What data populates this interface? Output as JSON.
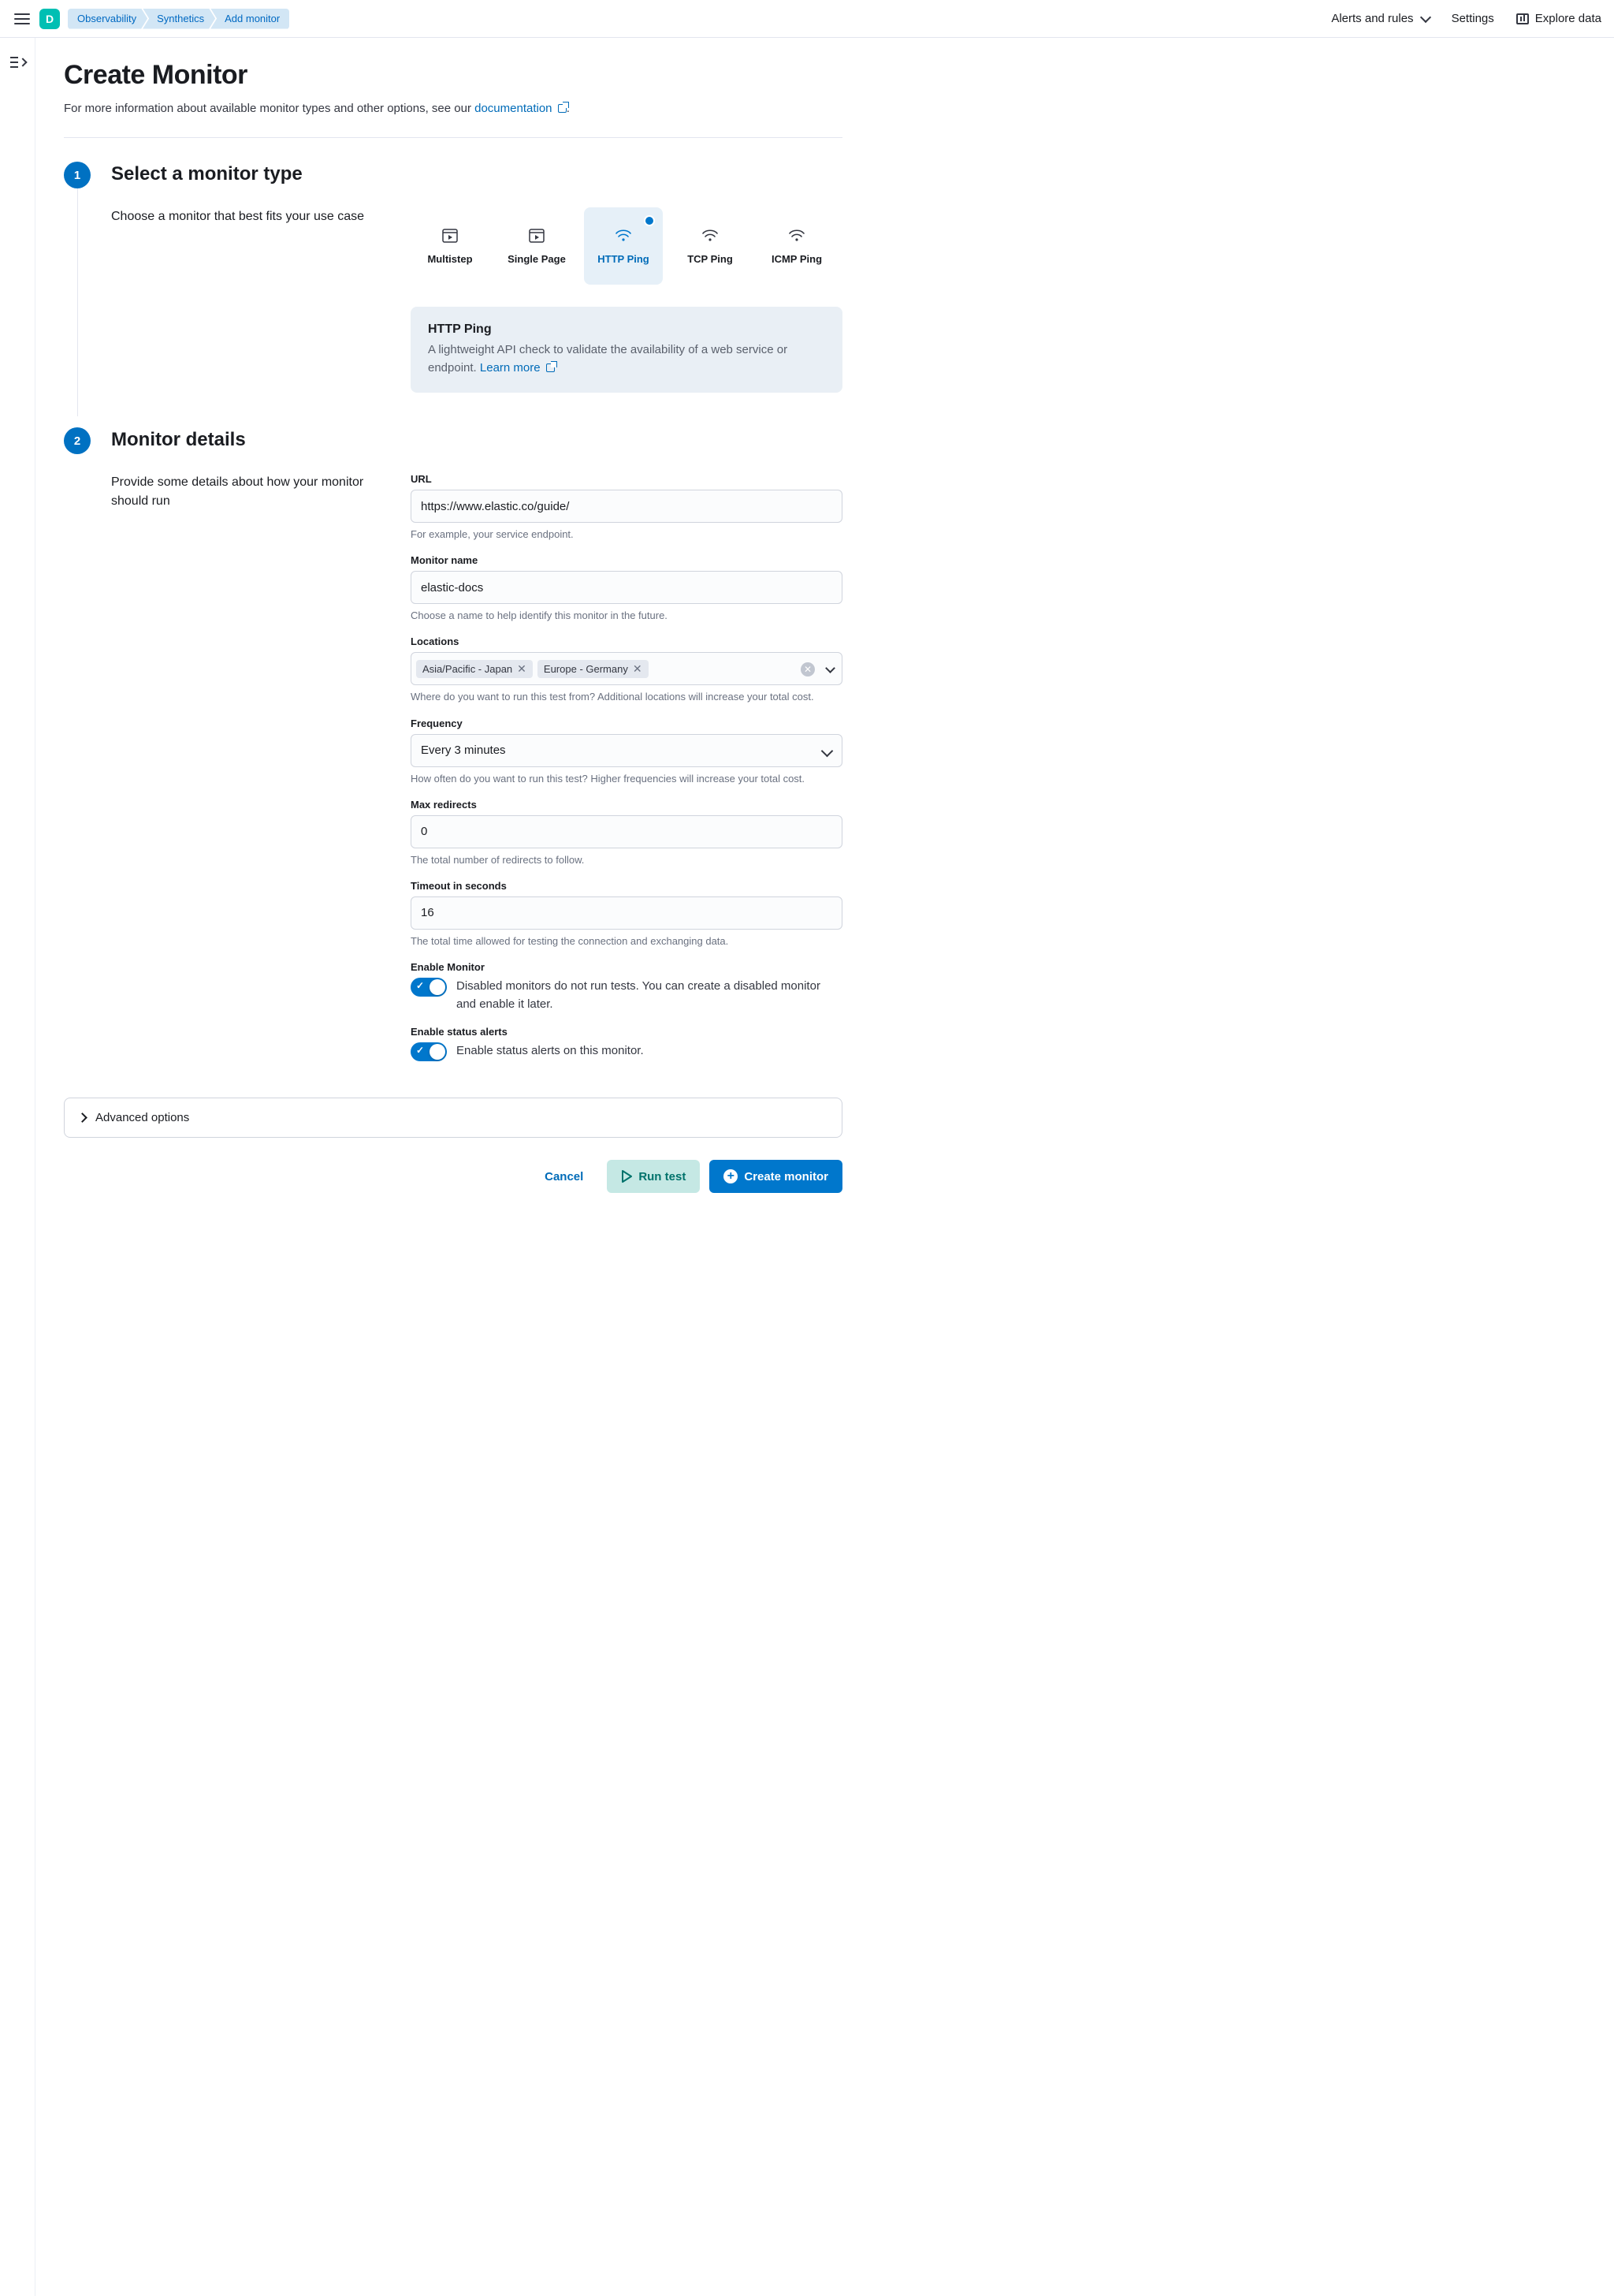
{
  "header": {
    "logo_letter": "D",
    "breadcrumbs": [
      "Observability",
      "Synthetics",
      "Add monitor"
    ],
    "alerts_label": "Alerts and rules",
    "settings_label": "Settings",
    "explore_label": "Explore data"
  },
  "page": {
    "title": "Create Monitor",
    "subtitle_prefix": "For more information about available monitor types and other options, see our ",
    "subtitle_link": "documentation",
    "subtitle_suffix": "."
  },
  "step1": {
    "number": "1",
    "title": "Select a monitor type",
    "desc": "Choose a monitor that best fits your use case",
    "types": [
      {
        "label": "Multistep"
      },
      {
        "label": "Single Page"
      },
      {
        "label": "HTTP Ping"
      },
      {
        "label": "TCP Ping"
      },
      {
        "label": "ICMP Ping"
      }
    ],
    "info_title": "HTTP Ping",
    "info_body": "A lightweight API check to validate the availability of a web service or endpoint. ",
    "info_link": "Learn more"
  },
  "step2": {
    "number": "2",
    "title": "Monitor details",
    "desc": "Provide some details about how your monitor should run",
    "url_label": "URL",
    "url_value": "https://www.elastic.co/guide/",
    "url_help": "For example, your service endpoint.",
    "name_label": "Monitor name",
    "name_value": "elastic-docs",
    "name_help": "Choose a name to help identify this monitor in the future.",
    "locations_label": "Locations",
    "locations": [
      "Asia/Pacific - Japan",
      "Europe - Germany"
    ],
    "locations_help": "Where do you want to run this test from? Additional locations will increase your total cost.",
    "freq_label": "Frequency",
    "freq_value": "Every 3 minutes",
    "freq_help": "How often do you want to run this test? Higher frequencies will increase your total cost.",
    "redirects_label": "Max redirects",
    "redirects_value": "0",
    "redirects_help": "The total number of redirects to follow.",
    "timeout_label": "Timeout in seconds",
    "timeout_value": "16",
    "timeout_help": "The total time allowed for testing the connection and exchanging data.",
    "enable_label": "Enable Monitor",
    "enable_desc": "Disabled monitors do not run tests. You can create a disabled monitor and enable it later.",
    "alerts_label": "Enable status alerts",
    "alerts_desc": "Enable status alerts on this monitor."
  },
  "advanced_label": "Advanced options",
  "footer": {
    "cancel": "Cancel",
    "run_test": "Run test",
    "create": "Create monitor"
  }
}
